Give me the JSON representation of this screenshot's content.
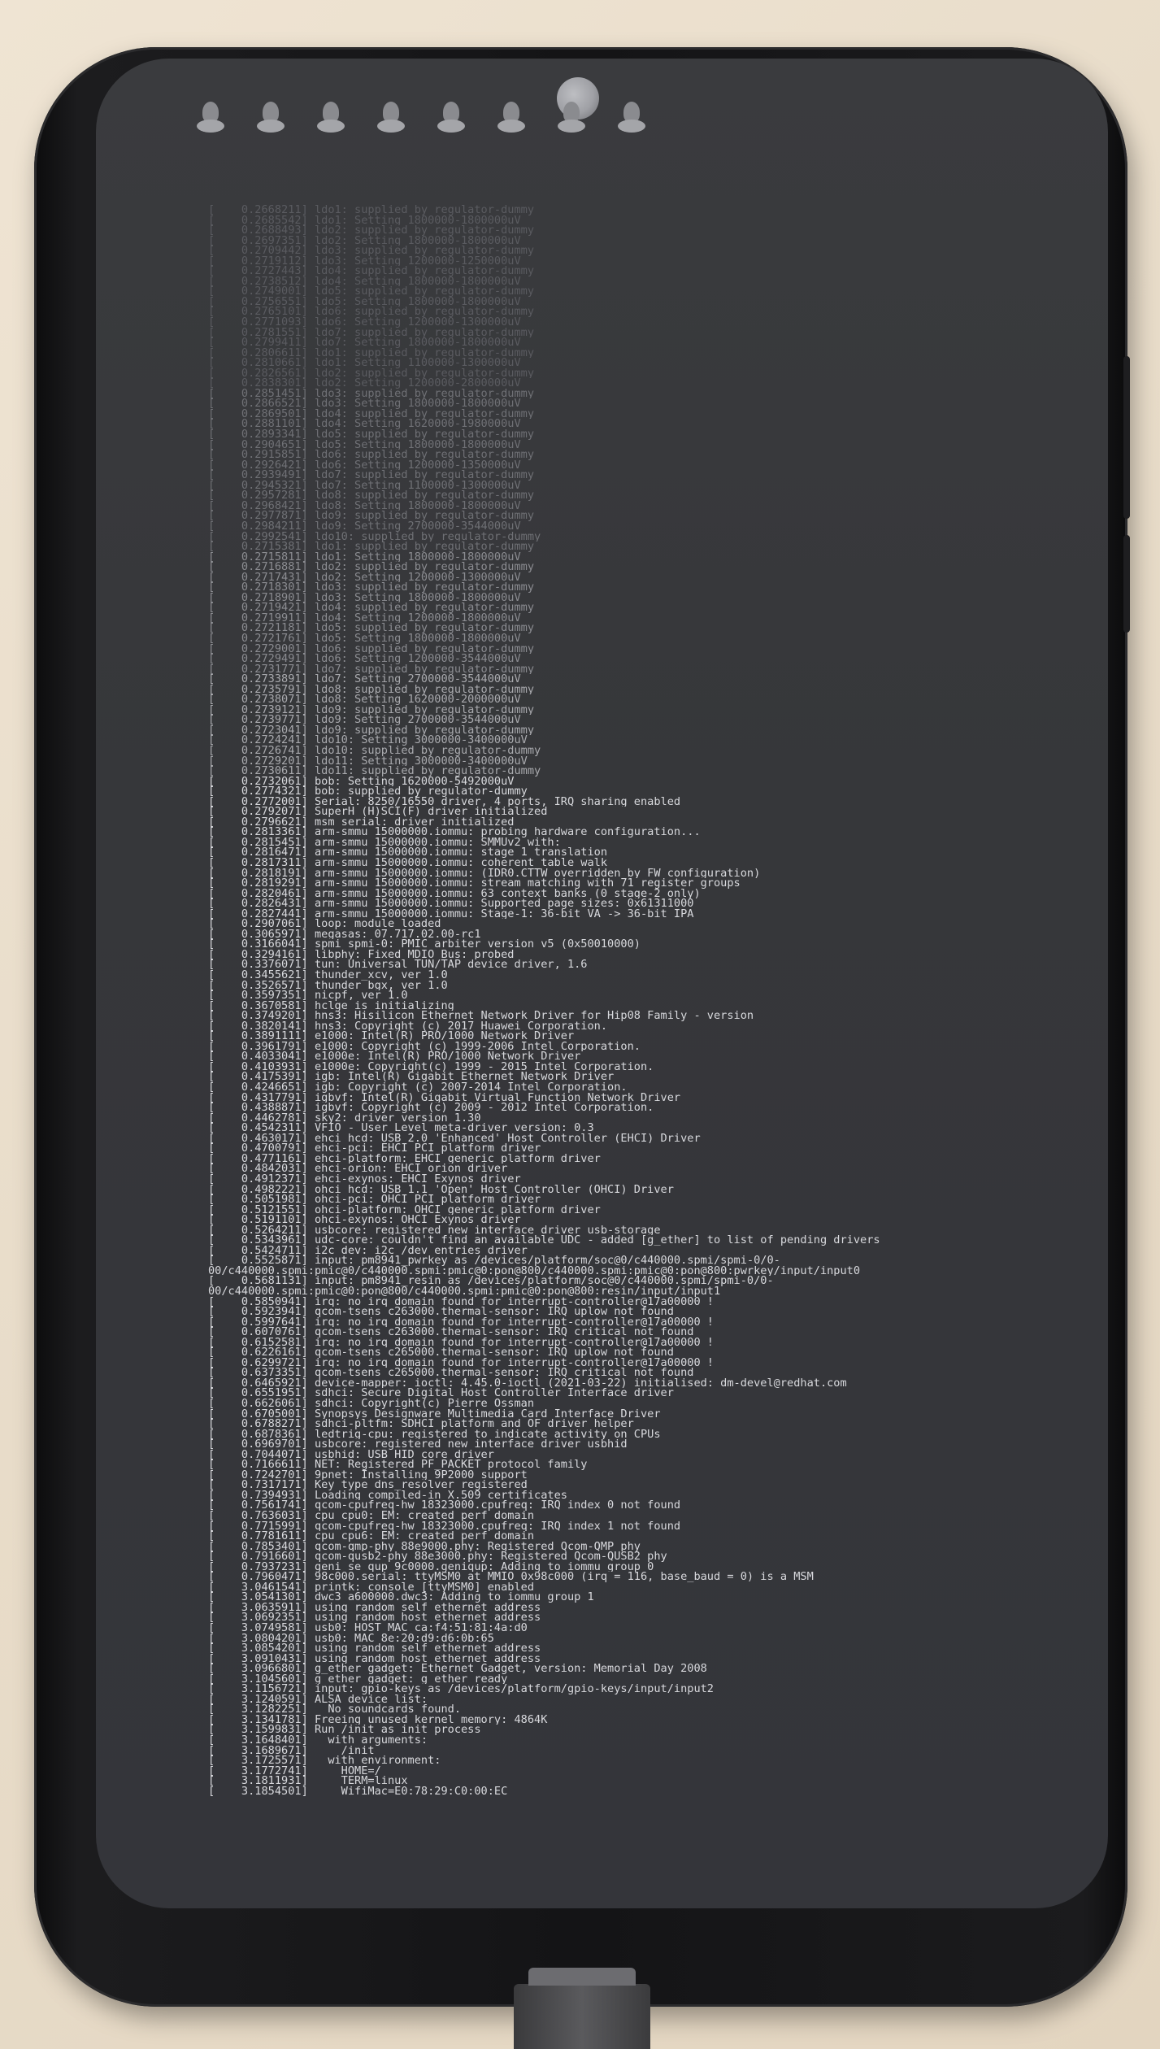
{
  "scene": {
    "description_free": true,
    "colors": {
      "background": "#e8dcc9",
      "phone_body": "#141416",
      "screen": "#36373a",
      "text": "#d8d9dd"
    },
    "penguin_logo_count": 8
  },
  "boot_log": {
    "lines": [
      "[    0.2668211] ldo1: supplied by regulator-dummy",
      "[    0.2685542] ldo1: Setting 1800000-1800000uV",
      "[    0.2688493] ldo2: supplied by regulator-dummy",
      "[    0.2697351] ldo2: Setting 1800000-1800000uV",
      "[    0.2709442] ldo3: supplied by regulator-dummy",
      "[    0.2719112] ldo3: Setting 1200000-1250000uV",
      "[    0.2727443] ldo4: supplied by regulator-dummy",
      "[    0.2738512] ldo4: Setting 1800000-1800000uV",
      "[    0.2749001] ldo5: supplied by regulator-dummy",
      "[    0.2756551] ldo5: Setting 1800000-1800000uV",
      "[    0.2765101] ldo6: supplied by regulator-dummy",
      "[    0.2771093] ldo6: Setting 1200000-1300000uV",
      "[    0.2781551] ldo7: supplied by regulator-dummy",
      "[    0.2799411] ldo7: Setting 1800000-1800000uV",
      "[    0.2806611] ldo1: supplied by regulator-dummy",
      "[    0.2810661] ldo1: Setting 1100000-1300000uV",
      "[    0.2826561] ldo2: supplied by regulator-dummy",
      "[    0.2838301] ldo2: Setting 1200000-2800000uV",
      "[    0.2851451] ldo3: supplied by regulator-dummy",
      "[    0.2866521] ldo3: Setting 1800000-1800000uV",
      "[    0.2869501] ldo4: supplied by regulator-dummy",
      "[    0.2881101] ldo4: Setting 1620000-1980000uV",
      "[    0.2893341] ldo5: supplied by regulator-dummy",
      "[    0.2904651] ldo5: Setting 1800000-1800000uV",
      "[    0.2915851] ldo6: supplied by regulator-dummy",
      "[    0.2926421] ldo6: Setting 1200000-1350000uV",
      "[    0.2939491] ldo7: supplied by regulator-dummy",
      "[    0.2945321] ldo7: Setting 1100000-1300000uV",
      "[    0.2957281] ldo8: supplied by regulator-dummy",
      "[    0.2968421] ldo8: Setting 1800000-1800000uV",
      "[    0.2977871] ldo9: supplied by regulator-dummy",
      "[    0.2984211] ldo9: Setting 2700000-3544000uV",
      "[    0.2992541] ldo10: supplied by regulator-dummy",
      "[    0.2715381] ldo1: supplied by regulator-dummy",
      "[    0.2715811] ldo1: Setting 1800000-1800000uV",
      "[    0.2716881] ldo2: supplied by regulator-dummy",
      "[    0.2717431] ldo2: Setting 1200000-1300000uV",
      "[    0.2718301] ldo3: supplied by regulator-dummy",
      "[    0.2718901] ldo3: Setting 1800000-1800000uV",
      "[    0.2719421] ldo4: supplied by regulator-dummy",
      "[    0.2719911] ldo4: Setting 1200000-1800000uV",
      "[    0.2721181] ldo5: supplied by regulator-dummy",
      "[    0.2721761] ldo5: Setting 1800000-1800000uV",
      "[    0.2729001] ldo6: supplied by regulator-dummy",
      "[    0.2729491] ldo6: Setting 1200000-3544000uV",
      "[    0.2731771] ldo7: supplied by regulator-dummy",
      "[    0.2733891] ldo7: Setting 2700000-3544000uV",
      "[    0.2735791] ldo8: supplied by regulator-dummy",
      "[    0.2738071] ldo8: Setting 1620000-2000000uV",
      "[    0.2739121] ldo9: supplied by regulator-dummy",
      "[    0.2739771] ldo9: Setting 2700000-3544000uV",
      "[    0.2723041] ldo9: supplied by regulator-dummy",
      "[    0.2724241] ldo10: Setting 3000000-3400000uV",
      "[    0.2726741] ldo10: supplied by regulator-dummy",
      "[    0.2729201] ldo11: Setting 3000000-3400000uV",
      "[    0.2730611] ldo11: supplied by regulator-dummy",
      "[    0.2732061] bob: Setting 1620000-5492000uV",
      "[    0.2774321] bob: supplied by regulator-dummy",
      "[    0.2772001] Serial: 8250/16550 driver, 4 ports, IRQ sharing enabled",
      "[    0.2792071] SuperH (H)SCI(F) driver initialized",
      "[    0.2796621] msm_serial: driver initialized",
      "[    0.2813361] arm-smmu 15000000.iommu: probing hardware configuration...",
      "[    0.2815451] arm-smmu 15000000.iommu: SMMUv2 with:",
      "[    0.2816471] arm-smmu 15000000.iommu: stage 1 translation",
      "[    0.2817311] arm-smmu 15000000.iommu: coherent table walk",
      "[    0.2818191] arm-smmu 15000000.iommu: (IDR0.CTTW overridden by FW configuration)",
      "[    0.2819291] arm-smmu 15000000.iommu: stream matching with 71 register groups",
      "[    0.2820461] arm-smmu 15000000.iommu: 63 context banks (0 stage-2 only)",
      "[    0.2826431] arm-smmu 15000000.iommu: Supported page sizes: 0x61311000",
      "[    0.2827441] arm-smmu 15000000.iommu: Stage-1: 36-bit VA -> 36-bit IPA",
      "[    0.2907061] loop: module loaded",
      "[    0.3065971] megasas: 07.717.02.00-rc1",
      "[    0.3166041] spmi spmi-0: PMIC arbiter version v5 (0x50010000)",
      "[    0.3294161] libphy: Fixed MDIO Bus: probed",
      "[    0.3376071] tun: Universal TUN/TAP device driver, 1.6",
      "[    0.3455621] thunder_xcv, ver 1.0",
      "[    0.3526571] thunder_bgx, ver 1.0",
      "[    0.3597351] nicpf, ver 1.0",
      "[    0.3670581] hclge is initializing",
      "[    0.3749201] hns3: Hisilicon Ethernet Network Driver for Hip08 Family - version",
      "[    0.3820141] hns3: Copyright (c) 2017 Huawei Corporation.",
      "[    0.3891111] e1000: Intel(R) PRO/1000 Network Driver",
      "[    0.3961791] e1000: Copyright (c) 1999-2006 Intel Corporation.",
      "[    0.4033041] e1000e: Intel(R) PRO/1000 Network Driver",
      "[    0.4103931] e1000e: Copyright(c) 1999 - 2015 Intel Corporation.",
      "[    0.4175391] igb: Intel(R) Gigabit Ethernet Network Driver",
      "[    0.4246651] igb: Copyright (c) 2007-2014 Intel Corporation.",
      "[    0.4317791] igbvf: Intel(R) Gigabit Virtual Function Network Driver",
      "[    0.4388871] igbvf: Copyright (c) 2009 - 2012 Intel Corporation.",
      "[    0.4462781] sky2: driver version 1.30",
      "[    0.4542311] VFIO - User Level meta-driver version: 0.3",
      "[    0.4630171] ehci_hcd: USB 2.0 'Enhanced' Host Controller (EHCI) Driver",
      "[    0.4700791] ehci-pci: EHCI PCI platform driver",
      "[    0.4771161] ehci-platform: EHCI generic platform driver",
      "[    0.4842031] ehci-orion: EHCI orion driver",
      "[    0.4912371] ehci-exynos: EHCI Exynos driver",
      "[    0.4982221] ohci_hcd: USB 1.1 'Open' Host Controller (OHCI) Driver",
      "[    0.5051981] ohci-pci: OHCI PCI platform driver",
      "[    0.5121551] ohci-platform: OHCI generic platform driver",
      "[    0.5191101] ohci-exynos: OHCI Exynos driver",
      "[    0.5264211] usbcore: registered new interface driver usb-storage",
      "[    0.5343961] udc-core: couldn't find an available UDC - added [g_ether] to list of pending drivers",
      "[    0.5424711] i2c_dev: i2c /dev entries driver",
      "[    0.5525871] input: pm8941_pwrkey as /devices/platform/soc@0/c440000.spmi/spmi-0/0-00/c440000.spmi:pmic@0/c440000.spmi:pmic@0:pon@800/c440000.spmi:pmic@0:pon@800:pwrkey/input/input0",
      "[    0.5681131] input: pm8941_resin as /devices/platform/soc@0/c440000.spmi/spmi-0/0-00/c440000.spmi:pmic@0:pon@800/c440000.spmi:pmic@0:pon@800:resin/input/input1",
      "[    0.5850941] irq: no irq domain found for interrupt-controller@17a00000 !",
      "[    0.5923941] qcom-tsens c263000.thermal-sensor: IRQ uplow not found",
      "[    0.5997641] irq: no irq domain found for interrupt-controller@17a00000 !",
      "[    0.6070761] qcom-tsens c263000.thermal-sensor: IRQ critical not found",
      "[    0.6152581] irq: no irq domain found for interrupt-controller@17a00000 !",
      "[    0.6226161] qcom-tsens c265000.thermal-sensor: IRQ uplow not found",
      "[    0.6299721] irq: no irq domain found for interrupt-controller@17a00000 !",
      "[    0.6373351] qcom-tsens c265000.thermal-sensor: IRQ critical not found",
      "[    0.6465921] device-mapper: ioctl: 4.45.0-ioctl (2021-03-22) initialised: dm-devel@redhat.com",
      "[    0.6551951] sdhci: Secure Digital Host Controller Interface driver",
      "[    0.6626061] sdhci: Copyright(c) Pierre Ossman",
      "[    0.6705001] Synopsys Designware Multimedia Card Interface Driver",
      "[    0.6788271] sdhci-pltfm: SDHCI platform and OF driver helper",
      "[    0.6878361] ledtrig-cpu: registered to indicate activity on CPUs",
      "[    0.6969701] usbcore: registered new interface driver usbhid",
      "[    0.7044071] usbhid: USB HID core driver",
      "[    0.7166611] NET: Registered PF_PACKET protocol family",
      "[    0.7242701] 9pnet: Installing 9P2000 support",
      "[    0.7317171] Key type dns_resolver registered",
      "[    0.7394931] Loading compiled-in X.509 certificates",
      "[    0.7561741] qcom-cpufreq-hw 18323000.cpufreq: IRQ index 0 not found",
      "[    0.7636031] cpu cpu0: EM: created perf domain",
      "[    0.7715991] qcom-cpufreq-hw 18323000.cpufreq: IRQ index 1 not found",
      "[    0.7781611] cpu cpu6: EM: created perf domain",
      "[    0.7853401] qcom-qmp-phy 88e9000.phy: Registered Qcom-QMP phy",
      "[    0.7916601] qcom-qusb2-phy 88e3000.phy: Registered Qcom-QUSB2 phy",
      "[    0.7937231] geni_se_qup 9c0000.geniqup: Adding to iommu group 0",
      "[    0.7960471] 98c000.serial: ttyMSM0 at MMIO 0x98c000 (irq = 116, base_baud = 0) is a MSM",
      "[    3.0461541] printk: console [ttyMSM0] enabled",
      "[    3.0541301] dwc3 a600000.dwc3: Adding to iommu group 1",
      "[    3.0635911] using random self ethernet address",
      "[    3.0692351] using random host ethernet address",
      "[    3.0749581] usb0: HOST MAC ca:f4:51:81:4a:d0",
      "[    3.0804201] usb0: MAC 8e:20:d9:d6:0b:65",
      "[    3.0854201] using random self ethernet address",
      "[    3.0910431] using random host ethernet address",
      "[    3.0966801] g_ether gadget: Ethernet Gadget, version: Memorial Day 2008",
      "[    3.1045601] g_ether gadget: g_ether ready",
      "[    3.1156721] input: gpio-keys as /devices/platform/gpio-keys/input/input2",
      "[    3.1240591] ALSA device list:",
      "[    3.1282251]   No soundcards found.",
      "[    3.1341781] Freeing unused kernel memory: 4864K",
      "[    3.1599831] Run /init as init process",
      "[    3.1648401]   with arguments:",
      "[    3.1689671]     /init",
      "[    3.1725571]   with environment:",
      "[    3.1772741]     HOME=/",
      "[    3.1811931]     TERM=linux",
      "[    3.1854501]     WifiMac=E0:78:29:C0:00:EC"
    ]
  }
}
